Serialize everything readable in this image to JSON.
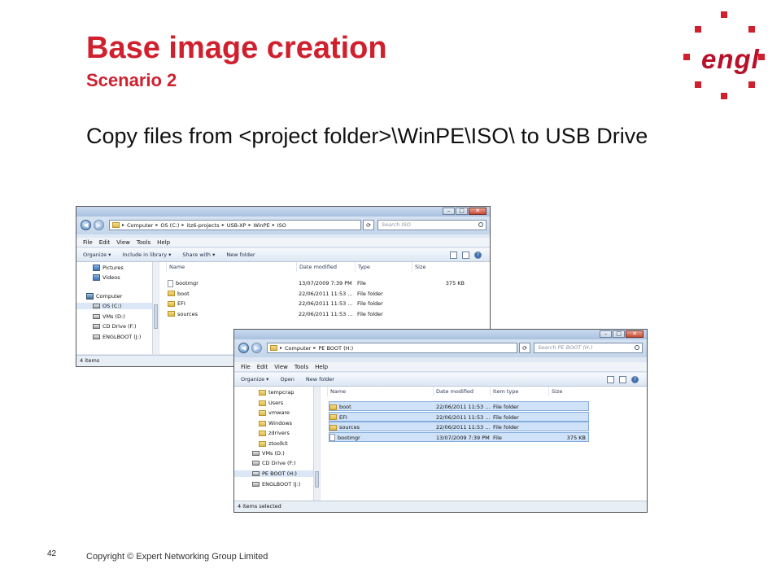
{
  "slide": {
    "title": "Base image creation",
    "subtitle": "Scenario 2",
    "body": "Copy files from <project folder>\\WinPE\\ISO\\ to USB Drive",
    "page_number": "42",
    "copyright": "Copyright  ©  Expert Networking Group Limited",
    "logo_text": "engl",
    "accent_color": "#d0202e"
  },
  "window1": {
    "address": [
      "Computer",
      "OS (C:)",
      "itz6-projects",
      "USB-XP",
      "WinPE",
      "ISO"
    ],
    "search_placeholder": "Search ISO",
    "menu": [
      "File",
      "Edit",
      "View",
      "Tools",
      "Help"
    ],
    "commands": [
      "Organize ▾",
      "Include in library ▾",
      "Share with ▾",
      "New folder"
    ],
    "nav": [
      {
        "label": "Pictures",
        "icon": "pictures-icon"
      },
      {
        "label": "Videos",
        "icon": "videos-icon"
      },
      {
        "label": "Computer",
        "icon": "computer-icon"
      },
      {
        "label": "OS (C:)",
        "icon": "drive-icon",
        "selected": true
      },
      {
        "label": "VMs (D:)",
        "icon": "drive-icon"
      },
      {
        "label": "CD Drive (F:)",
        "icon": "drive-icon"
      },
      {
        "label": "ENGLBOOT (J:)",
        "icon": "drive-icon"
      }
    ],
    "columns": [
      "Name",
      "Date modified",
      "Type",
      "Size"
    ],
    "files": [
      {
        "name": "bootmgr",
        "date": "13/07/2009 7:39 PM",
        "type": "File",
        "size": "375 KB",
        "kind": "file"
      },
      {
        "name": "boot",
        "date": "22/06/2011 11:53 ...",
        "type": "File folder",
        "size": "",
        "kind": "folder"
      },
      {
        "name": "EFI",
        "date": "22/06/2011 11:53 ...",
        "type": "File folder",
        "size": "",
        "kind": "folder"
      },
      {
        "name": "sources",
        "date": "22/06/2011 11:53 ...",
        "type": "File folder",
        "size": "",
        "kind": "folder"
      }
    ],
    "status": "4 items"
  },
  "window2": {
    "address": [
      "Computer",
      "PE BOOT (H:)"
    ],
    "search_placeholder": "Search PE BOOT (H:)",
    "menu": [
      "File",
      "Edit",
      "View",
      "Tools",
      "Help"
    ],
    "commands": [
      "Organize ▾",
      "Open",
      "New folder"
    ],
    "nav": [
      {
        "label": "tempcrap",
        "icon": "folder-icon"
      },
      {
        "label": "Users",
        "icon": "folder-icon"
      },
      {
        "label": "vmware",
        "icon": "folder-icon"
      },
      {
        "label": "Windows",
        "icon": "folder-icon"
      },
      {
        "label": "zdrivers",
        "icon": "folder-icon"
      },
      {
        "label": "ztoolkit",
        "icon": "folder-icon"
      },
      {
        "label": "VMs (D:)",
        "icon": "drive-icon"
      },
      {
        "label": "CD Drive (F:)",
        "icon": "drive-icon"
      },
      {
        "label": "PE BOOT (H:)",
        "icon": "drive-icon",
        "selected": true
      },
      {
        "label": "ENGLBOOT (J:)",
        "icon": "drive-icon"
      }
    ],
    "columns": [
      "Name",
      "Date modified",
      "Item type",
      "Size"
    ],
    "files": [
      {
        "name": "boot",
        "date": "22/06/2011 11:53 ...",
        "type": "File folder",
        "size": "",
        "kind": "folder"
      },
      {
        "name": "EFI",
        "date": "22/06/2011 11:53 ...",
        "type": "File folder",
        "size": "",
        "kind": "folder"
      },
      {
        "name": "sources",
        "date": "22/06/2011 11:53 ...",
        "type": "File folder",
        "size": "",
        "kind": "folder"
      },
      {
        "name": "bootmgr",
        "date": "13/07/2009 7:39 PM",
        "type": "File",
        "size": "375 KB",
        "kind": "file"
      }
    ],
    "status": "4 items selected"
  }
}
